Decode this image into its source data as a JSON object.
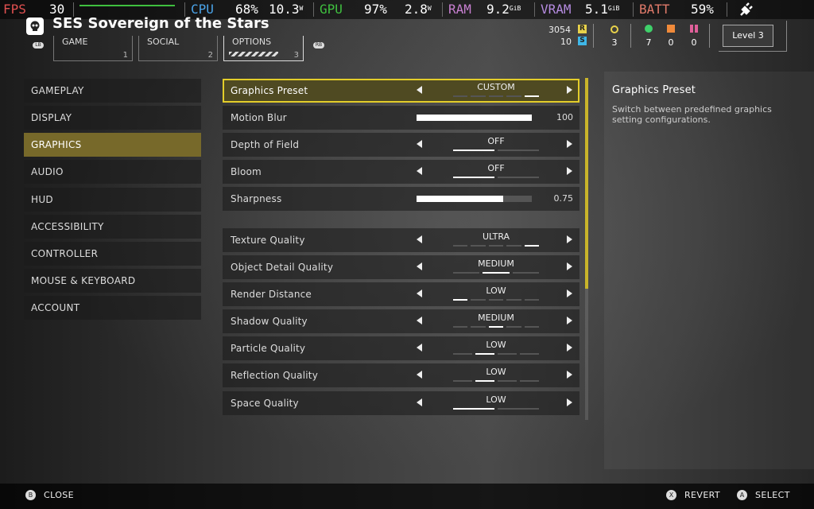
{
  "perf": {
    "fps_label": "FPS",
    "fps_value": "30",
    "cpu_label": "CPU",
    "cpu_pct": "68%",
    "cpu_watts": "10.3",
    "cpu_watts_unit": "W",
    "gpu_label": "GPU",
    "gpu_pct": "97%",
    "gpu_watts": "2.8",
    "gpu_watts_unit": "W",
    "ram_label": "RAM",
    "ram_value": "9.2",
    "ram_unit": "GiB",
    "vram_label": "VRAM",
    "vram_value": "5.1",
    "vram_unit": "GiB",
    "batt_label": "BATT",
    "batt_value": "59%",
    "colors": {
      "fps": "#e05050",
      "cpu": "#4aa3e8",
      "gpu": "#3fbf3f",
      "ram": "#c77fd0",
      "vram": "#b58be0",
      "batt": "#e07a6a"
    }
  },
  "header": {
    "title": "SES Sovereign of the Stars",
    "logo_icon": "skull-icon",
    "tabs": [
      {
        "label": "GAME",
        "num": "1"
      },
      {
        "label": "SOCIAL",
        "num": "2"
      },
      {
        "label": "OPTIONS",
        "num": "3"
      }
    ],
    "bumper_left": "LB",
    "bumper_right": "RB",
    "currency": [
      {
        "value": "3054",
        "badge": "R",
        "color": "#e8d24a"
      },
      {
        "value": "10",
        "badge": "S",
        "color": "#3fb7e8"
      }
    ],
    "stats": [
      {
        "icon": "medal-icon",
        "value": "3",
        "color": "#e8d24a"
      },
      {
        "icon": "green-circle-icon",
        "value": "7",
        "color": "#3fd06a"
      },
      {
        "icon": "orange-square-icon",
        "value": "0",
        "color": "#f08a3a"
      },
      {
        "icon": "pink-grid-icon",
        "value": "0",
        "color": "#e0609a"
      }
    ],
    "level": "Level 3"
  },
  "sidebar": {
    "items": [
      {
        "label": "GAMEPLAY"
      },
      {
        "label": "DISPLAY"
      },
      {
        "label": "GRAPHICS"
      },
      {
        "label": "AUDIO"
      },
      {
        "label": "HUD"
      },
      {
        "label": "ACCESSIBILITY"
      },
      {
        "label": "CONTROLLER"
      },
      {
        "label": "MOUSE & KEYBOARD"
      },
      {
        "label": "ACCOUNT"
      }
    ],
    "active": "GRAPHICS"
  },
  "settings": {
    "rows": [
      {
        "name": "Graphics Preset",
        "type": "select",
        "value": "CUSTOM",
        "option_index": 4,
        "option_count": 5,
        "selected": true
      },
      {
        "name": "Motion Blur",
        "type": "slider",
        "value": "100",
        "fraction": 1.0
      },
      {
        "name": "Depth of Field",
        "type": "select",
        "value": "OFF",
        "option_index": 0,
        "option_count": 2
      },
      {
        "name": "Bloom",
        "type": "select",
        "value": "OFF",
        "option_index": 0,
        "option_count": 2
      },
      {
        "name": "Sharpness",
        "type": "slider",
        "value": "0.75",
        "fraction": 0.75
      },
      {
        "name": "Texture Quality",
        "type": "select",
        "value": "ULTRA",
        "option_index": 4,
        "option_count": 5
      },
      {
        "name": "Object Detail Quality",
        "type": "select",
        "value": "MEDIUM",
        "option_index": 1,
        "option_count": 3
      },
      {
        "name": "Render Distance",
        "type": "select",
        "value": "LOW",
        "option_index": 0,
        "option_count": 5
      },
      {
        "name": "Shadow Quality",
        "type": "select",
        "value": "MEDIUM",
        "option_index": 2,
        "option_count": 5
      },
      {
        "name": "Particle Quality",
        "type": "select",
        "value": "LOW",
        "option_index": 1,
        "option_count": 4
      },
      {
        "name": "Reflection Quality",
        "type": "select",
        "value": "LOW",
        "option_index": 1,
        "option_count": 4
      },
      {
        "name": "Space Quality",
        "type": "select",
        "value": "LOW",
        "option_index": 0,
        "option_count": 2
      }
    ]
  },
  "description": {
    "title": "Graphics Preset",
    "body": "Switch between predefined graphics setting configurations."
  },
  "footer": {
    "close_glyph": "B",
    "close_label": "CLOSE",
    "revert_glyph": "X",
    "revert_label": "REVERT",
    "select_glyph": "A",
    "select_label": "SELECT"
  },
  "accent_color": "#e3cd2a"
}
